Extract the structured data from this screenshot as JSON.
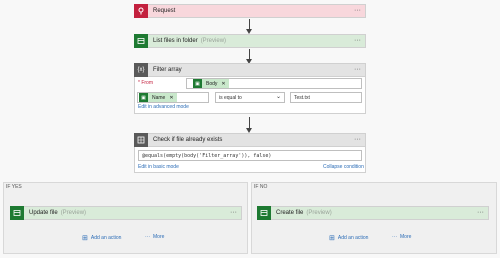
{
  "request": {
    "title": "Request",
    "more": "···"
  },
  "list_files": {
    "title": "List files in folder",
    "hint": "(Preview)",
    "more": "···"
  },
  "filter": {
    "title": "Filter array",
    "more": "···",
    "from_label": "* From",
    "from_token": "Body",
    "left_token": "Name",
    "operator": "is equal to",
    "value": "Test.txt",
    "advanced_link": "Edit in advanced mode"
  },
  "check": {
    "title": "Check if file already exists",
    "more": "···",
    "expression": "@equals(empty(body('Filter_array')), false)",
    "basic_link": "Edit in basic mode",
    "collapse_link": "Collapse condition"
  },
  "if_yes": {
    "label": "IF YES",
    "action_title": "Update file",
    "action_hint": "(Preview)",
    "more": "···",
    "add_action": "Add an action",
    "more_label": "More"
  },
  "if_no": {
    "label": "IF NO",
    "action_title": "Create file",
    "action_hint": "(Preview)",
    "more": "···",
    "add_action": "Add an action",
    "more_label": "More"
  },
  "colors": {
    "request": "#c3203e",
    "request_bg": "#f8d7dc",
    "green": "#1e7a32",
    "green_bg": "#d9ebd9",
    "filter": "#5a5a5a",
    "filter_bg": "#e3e3e3"
  }
}
